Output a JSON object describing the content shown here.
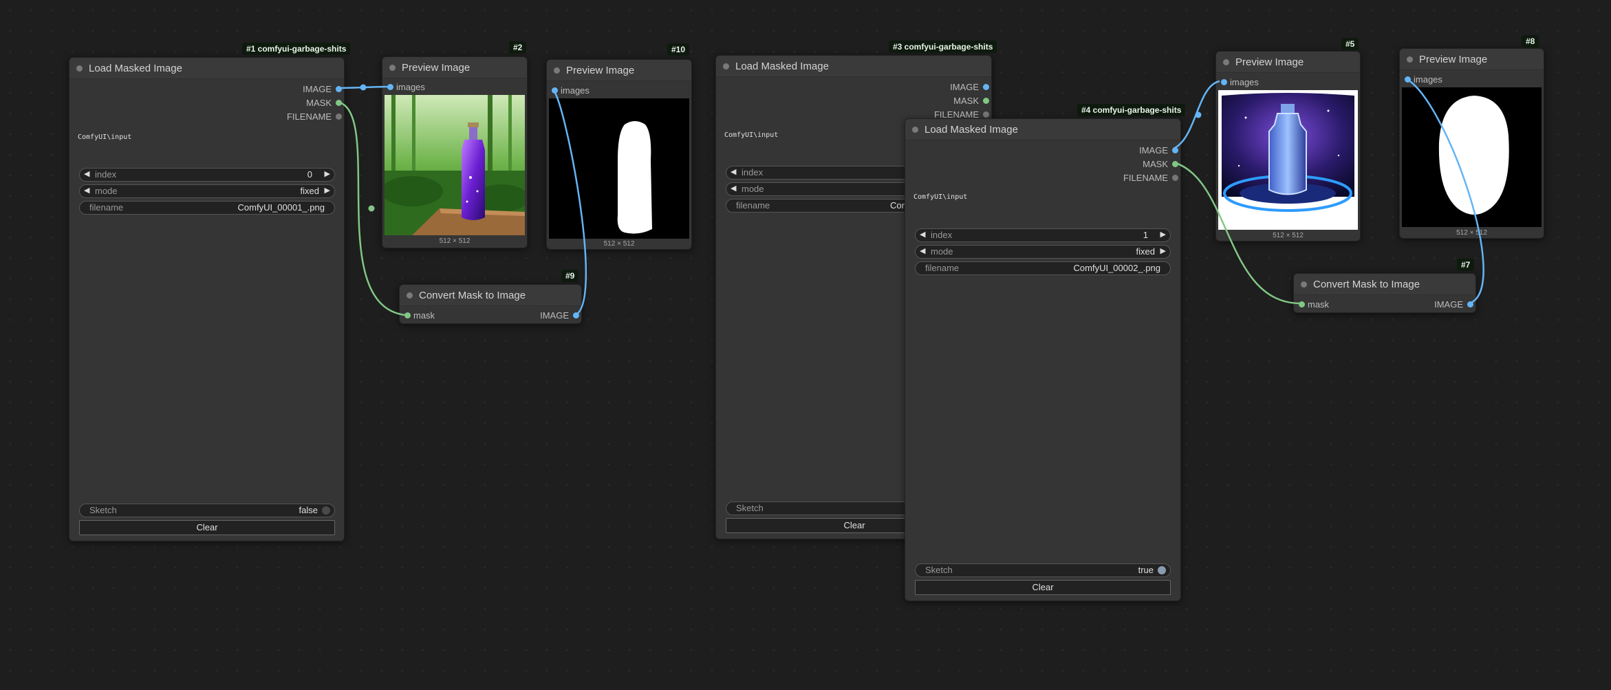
{
  "nodes": {
    "n1": {
      "badge": "#1 comfyui-garbage-shits",
      "title": "Load Masked Image",
      "outputs": [
        "IMAGE",
        "MASK",
        "FILENAME"
      ],
      "path": "ComfyUI\\input",
      "index_label": "index",
      "index_value": "0",
      "mode_label": "mode",
      "mode_value": "fixed",
      "filename_label": "filename",
      "filename_value": "ComfyUI_00001_.png",
      "sketch_label": "Sketch",
      "sketch_value": "false",
      "clear_label": "Clear"
    },
    "n2": {
      "badge": "#2",
      "title": "Preview Image",
      "input": "images",
      "dims": "512 × 512"
    },
    "n10": {
      "badge": "#10",
      "title": "Preview Image",
      "input": "images",
      "dims": "512 × 512"
    },
    "n9": {
      "badge": "#9",
      "title": "Convert Mask to Image",
      "input": "mask",
      "output": "IMAGE"
    },
    "n3": {
      "badge": "#3 comfyui-garbage-shits",
      "title": "Load Masked Image",
      "outputs": [
        "IMAGE",
        "MASK",
        "FILENAME"
      ],
      "path": "ComfyUI\\input",
      "index_label": "index",
      "mode_label": "mode",
      "filename_label": "filename",
      "filename_value": "Con",
      "sketch_label": "Sketch",
      "clear_label": "Clear"
    },
    "n4": {
      "badge": "#4 comfyui-garbage-shits",
      "title": "Load Masked Image",
      "outputs": [
        "IMAGE",
        "MASK",
        "FILENAME"
      ],
      "path": "ComfyUI\\input",
      "index_label": "index",
      "index_value": "1",
      "mode_label": "mode",
      "mode_value": "fixed",
      "filename_label": "filename",
      "filename_value": "ComfyUI_00002_.png",
      "sketch_label": "Sketch",
      "sketch_value": "true",
      "clear_label": "Clear"
    },
    "n5": {
      "badge": "#5",
      "title": "Preview Image",
      "input": "images",
      "dims": "512 × 512"
    },
    "n8": {
      "badge": "#8",
      "title": "Preview Image",
      "input": "images",
      "dims": "512 × 512"
    },
    "n7": {
      "badge": "#7",
      "title": "Convert Mask to Image",
      "input": "mask",
      "output": "IMAGE"
    }
  },
  "colors": {
    "image_wire": "#64b5f6",
    "mask_wire": "#81c784",
    "canvas": "#1e1e1e",
    "node_body": "#353535",
    "badge_bg": "#0f1a0f"
  },
  "icons": {
    "left_arrow": "◀",
    "right_arrow": "▶"
  }
}
